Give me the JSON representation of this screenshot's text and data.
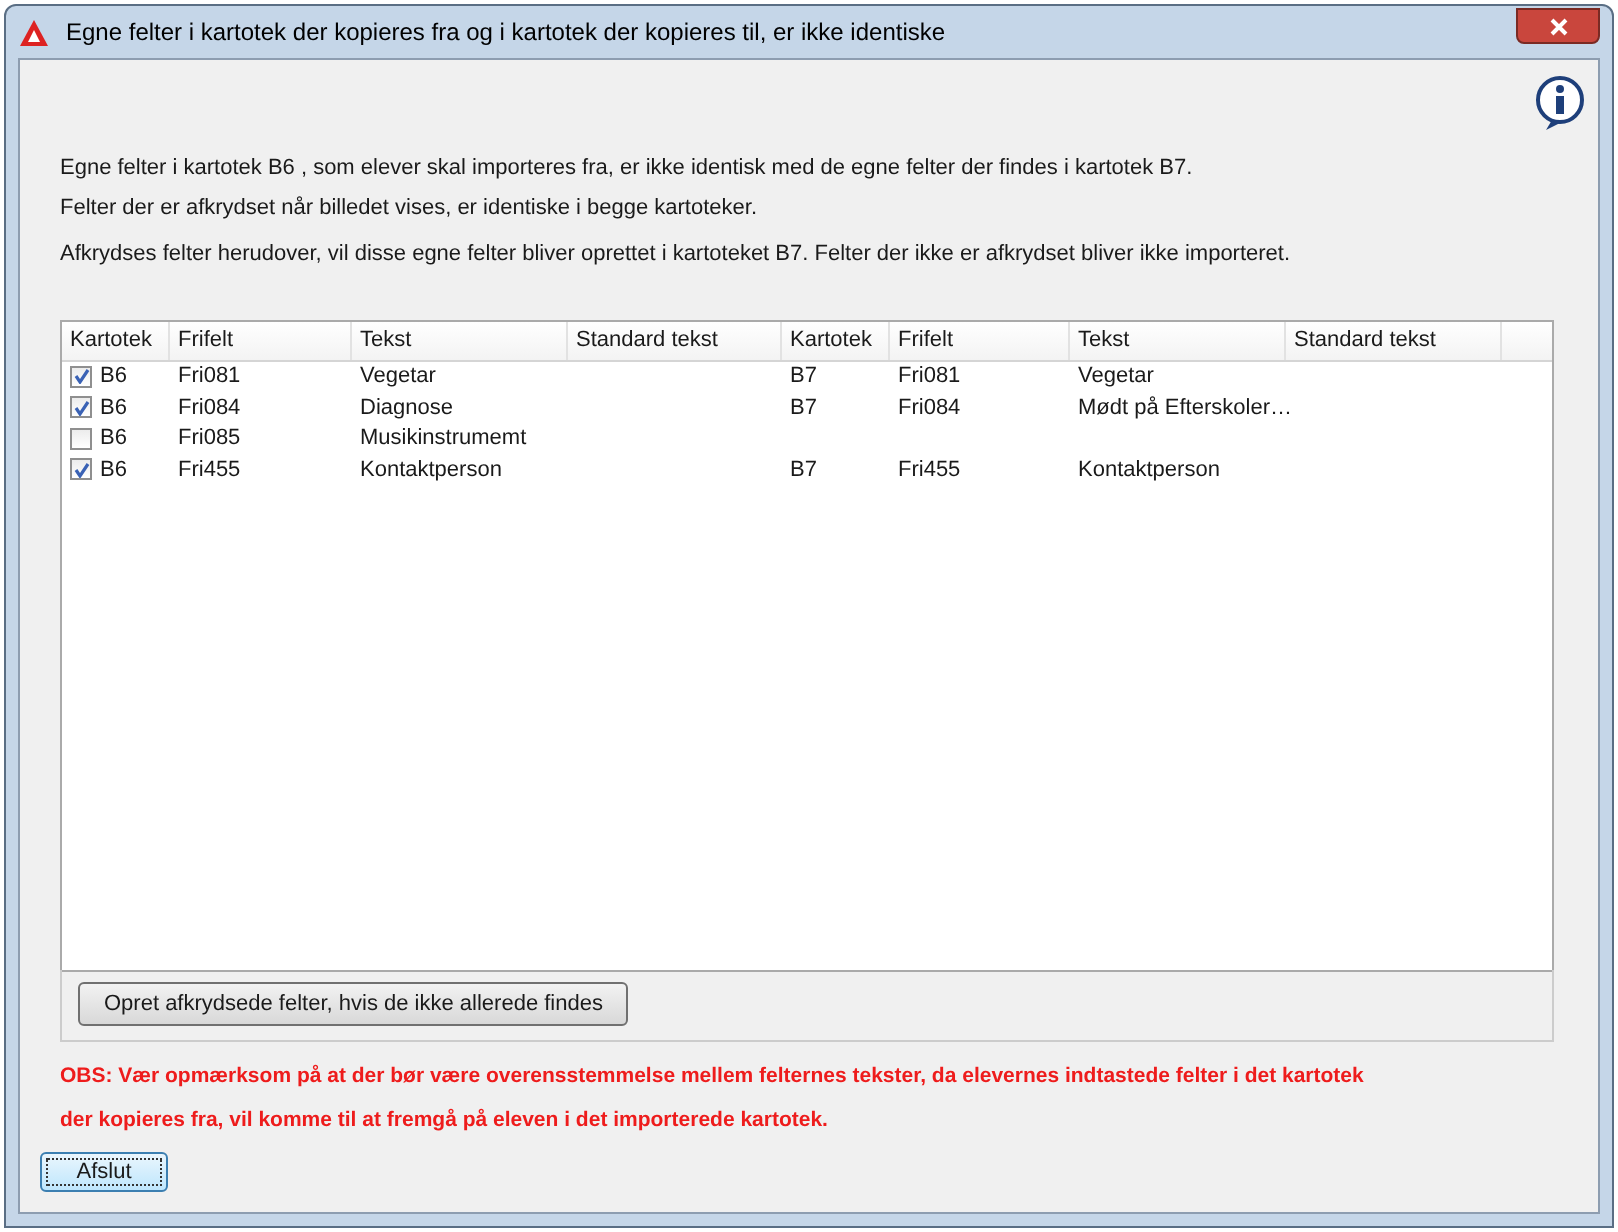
{
  "window": {
    "title": "Egne felter i kartotek der kopieres fra og i kartotek der kopieres til, er ikke identiske"
  },
  "intro": [
    "Egne felter i kartotek B6 , som elever skal importeres fra, er ikke identisk med de egne felter der findes i kartotek B7.",
    "Felter der er afkrydset når billedet vises, er identiske i begge kartoteker.",
    "Afkrydses felter herudover, vil disse egne felter bliver oprettet i kartoteket B7. Felter der ikke er afkrydset bliver ikke importeret."
  ],
  "table": {
    "columns": [
      "Kartotek",
      "Frifelt",
      "Tekst",
      "Standard tekst",
      "Kartotek",
      "Frifelt",
      "Tekst",
      "Standard tekst"
    ],
    "rows": [
      {
        "checked": true,
        "source": {
          "kartotek": "B6",
          "frifelt": "Fri081",
          "tekst": "Vegetar"
        },
        "target": {
          "kartotek": "B7",
          "frifelt": "Fri081",
          "tekst": "Vegetar"
        }
      },
      {
        "checked": true,
        "source": {
          "kartotek": "B6",
          "frifelt": "Fri084",
          "tekst": "Diagnose"
        },
        "target": {
          "kartotek": "B7",
          "frifelt": "Fri084",
          "tekst": "Mødt på Efterskoler…"
        }
      },
      {
        "checked": false,
        "source": {
          "kartotek": "B6",
          "frifelt": "Fri085",
          "tekst": "Musikinstrumemt"
        }
      },
      {
        "checked": true,
        "source": {
          "kartotek": "B6",
          "frifelt": "Fri455",
          "tekst": "Kontaktperson"
        },
        "target": {
          "kartotek": "B7",
          "frifelt": "Fri455",
          "tekst": "Kontaktperson"
        }
      }
    ]
  },
  "create_button": "Opret afkrydsede felter, hvis de ikke allerede findes",
  "warning_lines": [
    "OBS: Vær opmærksom på at der bør være overensstemmelse mellem felternes tekster, da elevernes indtastede felter i det kartotek",
    "der kopieres fra, vil komme til at fremgå på eleven i det importerede kartotek."
  ],
  "close_button": "Afslut"
}
